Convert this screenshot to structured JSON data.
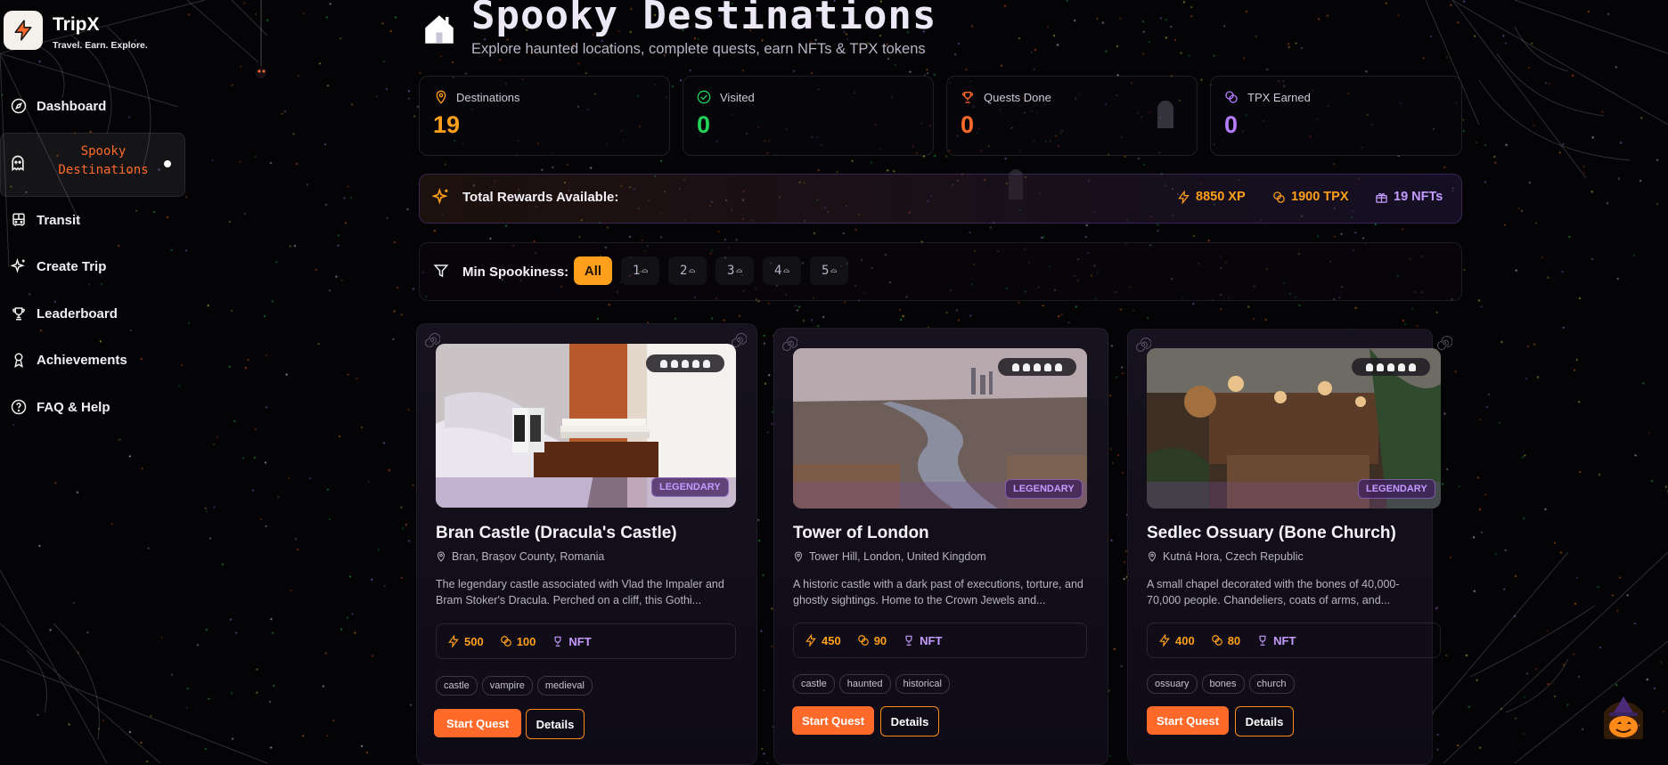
{
  "brand": {
    "name": "TripX",
    "tagline": "Travel. Earn. Explore."
  },
  "sidebar": {
    "items": [
      {
        "label": "Dashboard",
        "icon": "compass-icon"
      },
      {
        "label": "Spooky Destinations",
        "icon": "ghost-icon",
        "active": true
      },
      {
        "label": "Transit",
        "icon": "bus-icon"
      },
      {
        "label": "Create Trip",
        "icon": "sparkles-icon"
      },
      {
        "label": "Leaderboard",
        "icon": "trophy-icon"
      },
      {
        "label": "Achievements",
        "icon": "medal-icon"
      },
      {
        "label": "FAQ & Help",
        "icon": "help-circle-icon"
      }
    ],
    "active_label_line1": "Spooky",
    "active_label_line2": "Destinations"
  },
  "header": {
    "title": "Spooky Destinations",
    "subtitle": "Explore haunted locations, complete quests, earn NFTs & TPX tokens"
  },
  "stats": [
    {
      "label": "Destinations",
      "value": "19",
      "color": "#ff9f1a",
      "icon": "map-pin-icon"
    },
    {
      "label": "Visited",
      "value": "0",
      "color": "#22d35a",
      "icon": "check-circle-icon"
    },
    {
      "label": "Quests Done",
      "value": "0",
      "color": "#ff6a2a",
      "icon": "trophy-icon"
    },
    {
      "label": "TPX Earned",
      "value": "0",
      "color": "#b57cff",
      "icon": "coins-icon"
    }
  ],
  "rewards": {
    "title": "Total Rewards Available:",
    "xp": "8850 XP",
    "tpx": "1900 TPX",
    "nfts": "19 NFTs"
  },
  "filter": {
    "title": "Min Spookiness:",
    "options": [
      "All",
      "1",
      "2",
      "3",
      "4",
      "5"
    ],
    "selected": "All"
  },
  "cards": [
    {
      "title": "Bran Castle (Dracula's Castle)",
      "location": "Bran, Brașov County, Romania",
      "desc": "The legendary castle associated with Vlad the Impaler and Bram Stoker's Dracula. Perched on a cliff, this Gothi...",
      "rarity": "LEGENDARY",
      "rating": 5,
      "xp": "500",
      "tpx": "100",
      "nft": "NFT",
      "tags": [
        "castle",
        "vampire",
        "medieval"
      ],
      "primary": "Start Quest",
      "secondary": "Details"
    },
    {
      "title": "Tower of London",
      "location": "Tower Hill, London, United Kingdom",
      "desc": "A historic castle with a dark past of executions, torture, and ghostly sightings. Home to the Crown Jewels and...",
      "rarity": "LEGENDARY",
      "rating": 5,
      "xp": "450",
      "tpx": "90",
      "nft": "NFT",
      "tags": [
        "castle",
        "haunted",
        "historical"
      ],
      "primary": "Start Quest",
      "secondary": "Details"
    },
    {
      "title": "Sedlec Ossuary (Bone Church)",
      "location": "Kutná Hora, Czech Republic",
      "desc": "A small chapel decorated with the bones of 40,000-70,000 people. Chandeliers, coats of arms, and...",
      "rarity": "LEGENDARY",
      "rating": 5,
      "xp": "400",
      "tpx": "80",
      "nft": "NFT",
      "tags": [
        "ossuary",
        "bones",
        "church"
      ],
      "primary": "Start Quest",
      "secondary": "Details"
    }
  ],
  "colors": {
    "accent": "#ff6a2a",
    "gold": "#ff9f1a",
    "purple": "#b57cff",
    "green": "#22d35a"
  }
}
